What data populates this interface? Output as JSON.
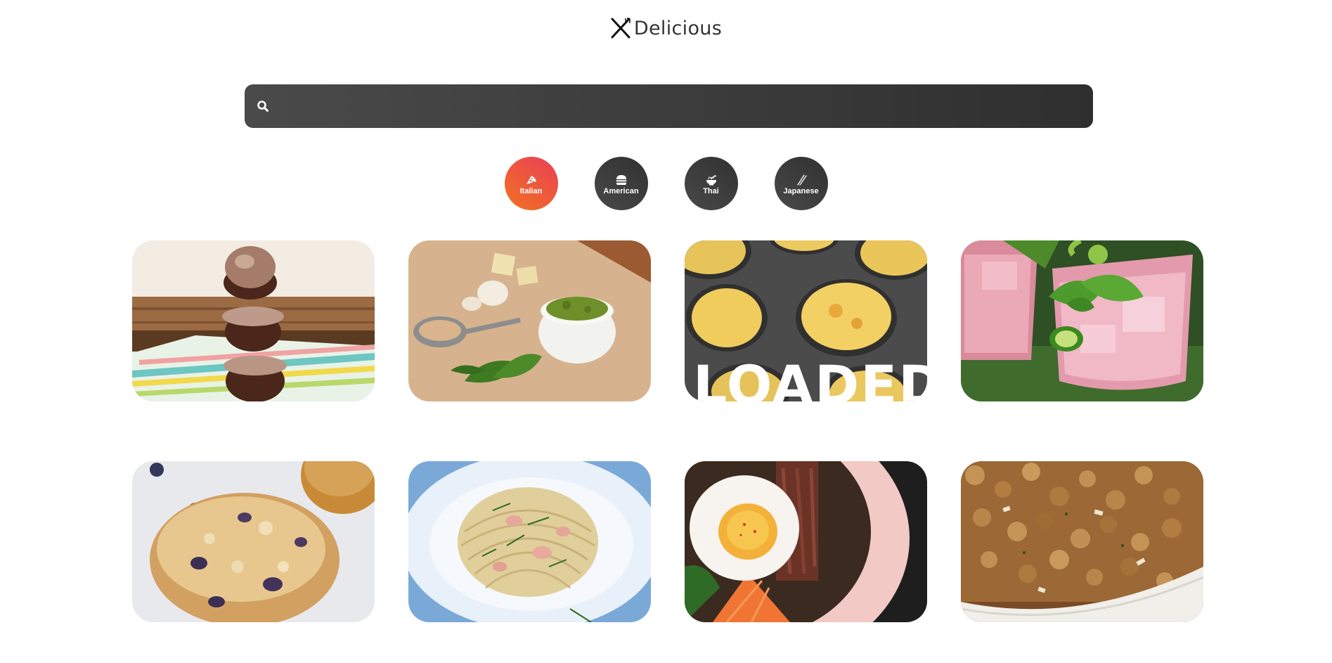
{
  "logo": {
    "text": "Delicious",
    "icon": "fork-knife-icon"
  },
  "search": {
    "icon": "search-icon",
    "value": "",
    "placeholder": ""
  },
  "categories": [
    {
      "label": "Italian",
      "icon": "pizza-icon",
      "active": true
    },
    {
      "label": "American",
      "icon": "hamburger-icon",
      "active": false
    },
    {
      "label": "Thai",
      "icon": "noodle-bowl-icon",
      "active": false
    },
    {
      "label": "Japanese",
      "icon": "chopsticks-icon",
      "active": false
    }
  ],
  "recipes": [
    {
      "image": "stacked chocolate cupcakes"
    },
    {
      "image": "pesto with garlic and pine nuts"
    },
    {
      "image": "egg muffins in tin",
      "overlay_text": "LOADED"
    },
    {
      "image": "pink drink with mint and jalapeno"
    },
    {
      "image": "blueberry muffin"
    },
    {
      "image": "spaghetti with salmon and chives"
    },
    {
      "image": "bibimbap with fried egg"
    },
    {
      "image": "baked stuffing casserole"
    }
  ],
  "colors": {
    "active_gradient_start": "#f27121",
    "active_gradient_end": "#e94057",
    "dark": "#313131",
    "search_bg": "#3a3a3a"
  }
}
